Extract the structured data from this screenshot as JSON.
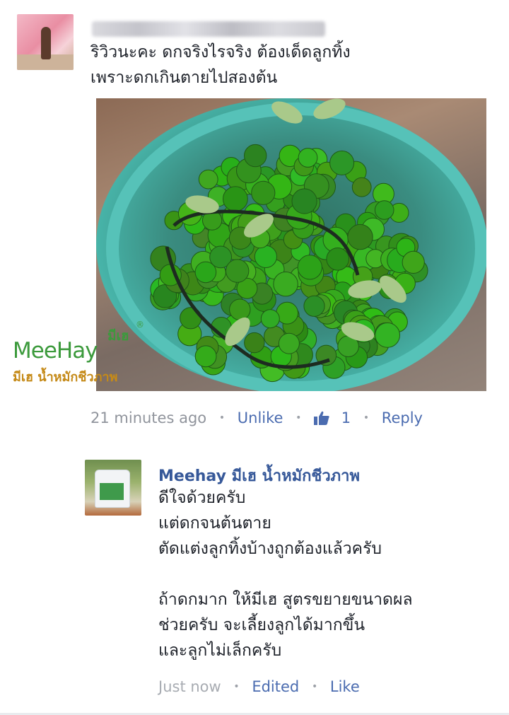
{
  "comment": {
    "text": "ริวิวนะคะ ดกจริงไรจริง ต้องเด็ดลูกทิ้ง\nเพราะดกเกินตายไปสองต้น",
    "photo": {
      "watermark_main": "MeeHay",
      "watermark_thai_top": "มีเฮ",
      "watermark_registered": "®",
      "watermark_sub": "มีเฮ น้ำหมักชีวภาพ"
    },
    "meta": {
      "time": "21 minutes ago",
      "unlike_label": "Unlike",
      "like_count": "1",
      "reply_label": "Reply"
    }
  },
  "reply": {
    "author": "Meehay มีเฮ น้ำหมักชีวภาพ",
    "text": "ดีใจด้วยครับ\nแต่ดกจนต้นตาย\nตัดแต่งลูกทิ้งบ้างถูกต้องแล้วครับ\n\nถ้าดกมาก ให้มีเฮ สูตรขยายขนาดผล\nช่วยครับ จะเลี้ยงลูกได้มากขึ้น\nและลูกไม่เล็กครับ",
    "meta": {
      "time": "Just now",
      "edited_label": "Edited",
      "like_label": "Like"
    }
  },
  "colors": {
    "link": "#4b6cb0",
    "meta_grey": "#90949c",
    "author": "#365899",
    "watermark_green": "#3c9a3c",
    "watermark_gold": "#c58a18"
  }
}
